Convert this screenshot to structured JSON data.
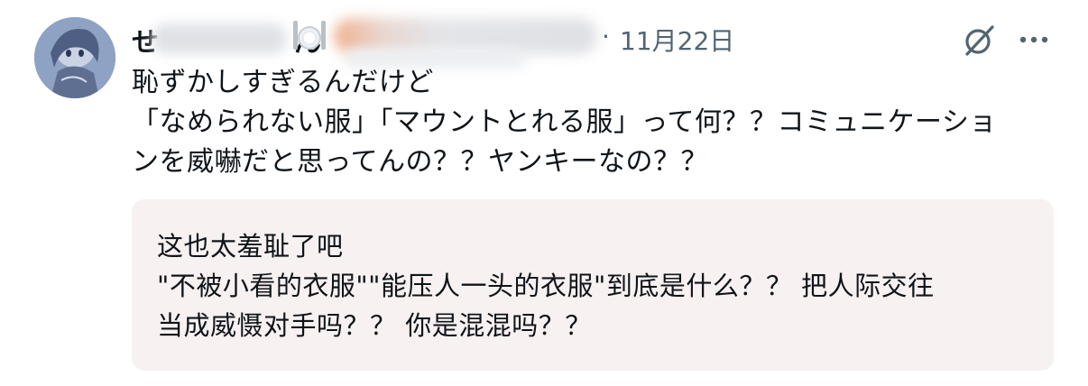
{
  "post": {
    "author_name": "せ",
    "author_name_tail": "ん",
    "separator": "·",
    "date": "11月22日",
    "body_lines": [
      "恥ずかしすぎるんだけど",
      "「なめられない服」「マウントとれる服」って何？？コミュニケーショ",
      "ンを威嚇だと思ってんの？？ヤンキーなの？？"
    ],
    "translation_lines": [
      "这也太羞耻了吧",
      "\"不被小看的衣服\"\"能压人一头的衣服\"到底是什么？？ 把人际交往",
      "当成威慑对手吗？？ 你是混混吗？？"
    ]
  },
  "colors": {
    "text": "#0f1419",
    "muted": "#536471",
    "translation_bg": "#f8f1f1"
  },
  "icons": {
    "avatar": "avatar-image",
    "emoji": "fork-knife-plate-icon",
    "grok": "grok-icon",
    "more": "more-horizontal-icon"
  }
}
